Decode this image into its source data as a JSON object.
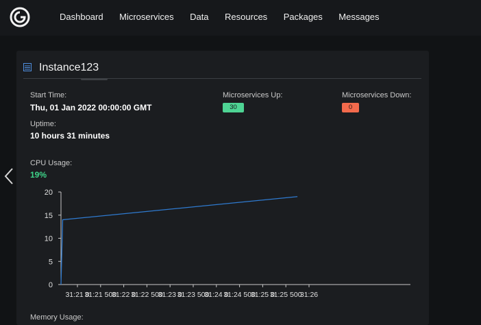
{
  "nav": {
    "items": [
      "Dashboard",
      "Microservices",
      "Data",
      "Resources",
      "Packages",
      "Messages"
    ]
  },
  "instance": {
    "title": "Instance123",
    "start_time_label": "Start Time:",
    "start_time_value": "Thu, 01 Jan 2022 00:00:00 GMT",
    "uptime_label": "Uptime:",
    "uptime_value": "10 hours 31 minutes",
    "up_label": "Microservices Up:",
    "up_value": "30",
    "down_label": "Microservices Down:",
    "down_value": "0",
    "cpu_label": "CPU Usage:",
    "cpu_value": "19%",
    "memory_label": "Memory Usage:"
  },
  "colors": {
    "accent_green": "#3ed58a",
    "badge_up": "#4ed494",
    "badge_down": "#f26a4c",
    "line": "#2f7bd1"
  },
  "chart_data": {
    "type": "line",
    "x": [
      "",
      "31:21 0",
      "31:21 500",
      "31:22 0",
      "31:22 500",
      "31:23 0",
      "31:23 500",
      "31:24 0",
      "31:24 500",
      "31:25 0",
      "31:25 500",
      "31:26"
    ],
    "xticks": [
      "31:21 0",
      "31:21 500",
      "31:22 0",
      "31:22 500",
      "31:23 0",
      "31:23 500",
      "31:24 0",
      "31:24 500",
      "31:25 0",
      "31:25 500",
      "31:26"
    ],
    "yticks": [
      "0",
      "5",
      "10",
      "15",
      "20"
    ],
    "series": [
      {
        "x_index": [
          0,
          0.33,
          10.5
        ],
        "values": [
          0,
          14,
          19
        ]
      }
    ],
    "ylim": [
      0,
      20
    ],
    "grid": false
  }
}
